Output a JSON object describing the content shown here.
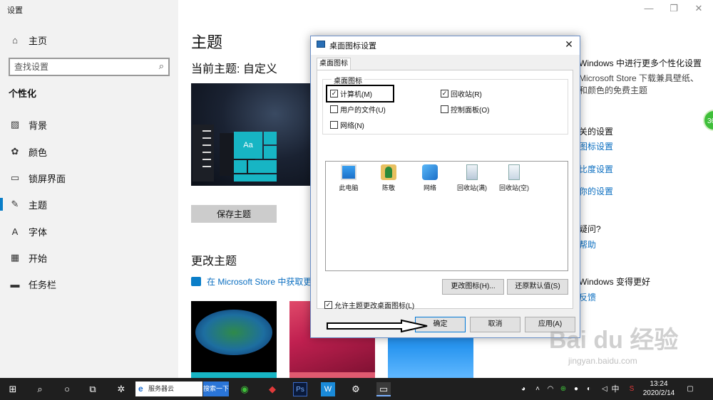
{
  "settings": {
    "app_title": "设置",
    "home": "主页",
    "search_placeholder": "查找设置",
    "group": "个性化",
    "nav": [
      {
        "label": "背景",
        "icon": "picture-icon"
      },
      {
        "label": "颜色",
        "icon": "palette-icon"
      },
      {
        "label": "锁屏界面",
        "icon": "lockscreen-icon"
      },
      {
        "label": "主题",
        "icon": "theme-icon"
      },
      {
        "label": "字体",
        "icon": "font-icon"
      },
      {
        "label": "开始",
        "icon": "start-icon"
      },
      {
        "label": "任务栏",
        "icon": "taskbar-icon"
      }
    ],
    "active_nav": "主题"
  },
  "main": {
    "title": "主题",
    "current_theme": "当前主题: 自定义",
    "save_button": "保存主题",
    "change_theme": "更改主题",
    "store_link": "在 Microsoft Store 中获取更",
    "right": {
      "line1": "Windows 中进行更多个性化设置",
      "line2": "Microsoft Store 下载兼具壁纸、",
      "line3": "和颜色的免费主题",
      "related_partial": "关的设置",
      "link1": "图标设置",
      "link2": "比度设置",
      "link3": "你的设置",
      "question": "疑问?",
      "help": "帮助",
      "better": "Windows 变得更好",
      "feedback": "反馈"
    }
  },
  "dialog": {
    "title": "桌面图标设置",
    "close": "✕",
    "tab": "桌面图标",
    "legend": "桌面图标",
    "checkboxes": [
      {
        "label": "计算机(M)",
        "checked": true
      },
      {
        "label": "回收站(R)",
        "checked": true
      },
      {
        "label": "用户的文件(U)",
        "checked": false
      },
      {
        "label": "控制面板(O)",
        "checked": false
      },
      {
        "label": "网络(N)",
        "checked": false
      }
    ],
    "icons": [
      "此电脑",
      "陈敬",
      "网络",
      "回收站(满)",
      "回收站(空)"
    ],
    "change_icon_button": "更改图标(H)...",
    "restore_default_button": "还原默认值(S)",
    "allow_themes_checkbox": "允许主题更改桌面图标(L)",
    "allow_themes_checked": true,
    "ok_button": "确定",
    "cancel_button": "取消",
    "apply_button": "应用(A)"
  },
  "taskbar": {
    "search_text": "服务器云",
    "search_button": "搜索一下",
    "ime": "中",
    "time": "13:24",
    "date": "2020/2/14"
  },
  "watermark": {
    "logo_text": "Bai du 经验",
    "url": "jingyan.baidu.com"
  },
  "colors": {
    "accent": "#0a7ec8",
    "link": "#0a6ec0",
    "tile": "#17b5c4",
    "taskbar": "#1f1f1f"
  }
}
